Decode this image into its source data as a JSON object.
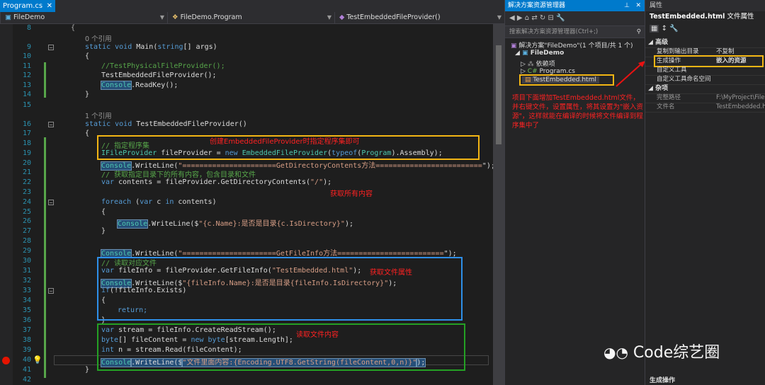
{
  "tab": {
    "label": "Program.cs",
    "close": "✕"
  },
  "nav": {
    "project": "FileDemo",
    "class": "FileDemo.Program",
    "method": "TestEmbeddedFileProvider()"
  },
  "lines": [
    {
      "n": "8",
      "t": "{"
    },
    {
      "n": "",
      "t": "0 个引用"
    },
    {
      "n": "9",
      "t": "static void Main(string[] args)"
    },
    {
      "n": "10",
      "t": "{"
    },
    {
      "n": "11",
      "t": "//TestPhysicalFileProvider();"
    },
    {
      "n": "12",
      "t": "TestEmbeddedFileProvider();"
    },
    {
      "n": "13",
      "t": "Console.ReadKey();"
    },
    {
      "n": "14",
      "t": "}"
    },
    {
      "n": "15",
      "t": ""
    },
    {
      "n": "",
      "t": "1 个引用"
    },
    {
      "n": "16",
      "t": "static void TestEmbeddedFileProvider()"
    },
    {
      "n": "17",
      "t": "{"
    },
    {
      "n": "18",
      "t": "// 指定程序集"
    },
    {
      "n": "19",
      "t": "IFileProvider fileProvider = new EmbeddedFileProvider(typeof(Program).Assembly);"
    },
    {
      "n": "20",
      "t": "Console.WriteLine(\"======================GetDirectoryContents方法=========================\");"
    },
    {
      "n": "21",
      "t": "// 获取指定目录下的所有内容，包含目录和文件"
    },
    {
      "n": "22",
      "t": "var contents = fileProvider.GetDirectoryContents(\"/\");"
    },
    {
      "n": "23",
      "t": ""
    },
    {
      "n": "24",
      "t": "foreach (var c in contents)"
    },
    {
      "n": "25",
      "t": "{"
    },
    {
      "n": "26",
      "t": "Console.WriteLine($\"{c.Name}:是否是目录{c.IsDirectory}\");"
    },
    {
      "n": "27",
      "t": "}"
    },
    {
      "n": "28",
      "t": ""
    },
    {
      "n": "29",
      "t": "Console.WriteLine(\"======================GetFileInfo方法=========================\");"
    },
    {
      "n": "30",
      "t": "// 读取对应文件"
    },
    {
      "n": "31",
      "t": "var fileInfo = fileProvider.GetFileInfo(\"TestEmbedded.html\");"
    },
    {
      "n": "32",
      "t": "Console.WriteLine($\"{fileInfo.Name}:是否是目录{fileInfo.IsDirectory}\");"
    },
    {
      "n": "33",
      "t": "if(!fileInfo.Exists)"
    },
    {
      "n": "34",
      "t": "{"
    },
    {
      "n": "35",
      "t": "return;"
    },
    {
      "n": "36",
      "t": "}"
    },
    {
      "n": "37",
      "t": "var stream = fileInfo.CreateReadStream();"
    },
    {
      "n": "38",
      "t": "byte[] fileContent = new byte[stream.Length];"
    },
    {
      "n": "39",
      "t": "int n = stream.Read(fileContent);"
    },
    {
      "n": "40",
      "t": "Console.WriteLine($\"文件里面内容:{Encoding.UTF8.GetString(fileContent,0,n)}\");"
    },
    {
      "n": "41",
      "t": "}"
    },
    {
      "n": "42",
      "t": ""
    }
  ],
  "annotations": {
    "a1": "创建EmbeddedFileProvider时指定程序集即可",
    "a2": "获取所有内容",
    "a3": "获取文件属性",
    "a4": "读取文件内容",
    "a5": "项目下面增加TestEmbedded.html文件，并右键文件，设置属性，将其设置为\"嵌入资源\"，这样就能在编译的时候将文件编译到程序集中了"
  },
  "solution": {
    "title": "解决方案资源管理器",
    "search_placeholder": "搜索解决方案资源管理器(Ctrl+;)",
    "items": [
      "解决方案\"FileDemo\"(1 个项目/共 1 个)",
      "FileDemo",
      "依赖项",
      "Program.cs",
      "TestEmbedded.html"
    ]
  },
  "properties": {
    "title": "属性",
    "subject": "TestEmbedded.html",
    "subject_type": "文件属性",
    "cat_advanced": "高级",
    "cat_misc": "杂项",
    "rows": [
      {
        "name": "复制到输出目录",
        "value": "不复制"
      },
      {
        "name": "生成操作",
        "value": "嵌入的资源"
      },
      {
        "name": "自定义工具",
        "value": ""
      },
      {
        "name": "自定义工具命名空间",
        "value": ""
      },
      {
        "name": "完整路径",
        "value": "F:\\MyProject\\FileD"
      },
      {
        "name": "文件名",
        "value": "TestEmbedded.h"
      }
    ],
    "footer": "生成操作"
  },
  "watermark": "Code综艺圈"
}
